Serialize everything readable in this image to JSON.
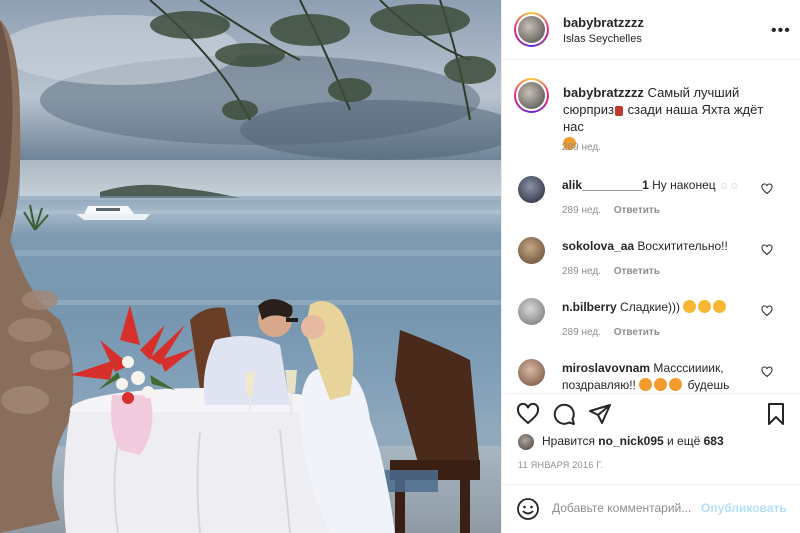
{
  "header": {
    "username": "babybratzzzz",
    "location": "Islas Seychelles"
  },
  "caption": {
    "username": "babybratzzzz",
    "text": "Самый лучший сюрприз",
    "text_after": "сзади наша Яхта ждёт нас",
    "time": "289 нед."
  },
  "comments": [
    {
      "username": "alik_________1",
      "text": "Ну наконец",
      "time": "289 нед.",
      "reply": "Ответить"
    },
    {
      "username": "sokolova_aa",
      "text": "Восхитительно!!",
      "time": "289 нед.",
      "reply": "Ответить"
    },
    {
      "username": "n.bilberry",
      "text": "Сладкие)))",
      "time": "289 нед.",
      "reply": "Ответить"
    },
    {
      "username": "miroslavovnam",
      "text": "Масссиииик, поздравляю!!",
      "text_after": "будешь",
      "time": "",
      "reply": ""
    }
  ],
  "likes": {
    "prefix": "Нравится",
    "user": "no_nick095",
    "middle": "и ещё",
    "count": "683"
  },
  "date": "11 ЯНВАРЯ 2016 Г.",
  "add_comment": {
    "placeholder": "Добавьте комментарий...",
    "publish": "Опубликовать"
  },
  "icons": {
    "more": "more-options-icon",
    "like": "heart-icon",
    "comment": "comment-icon",
    "share": "share-icon",
    "save": "bookmark-icon",
    "emoji": "emoji-icon"
  },
  "colors": {
    "link_disabled": "#b2dffc",
    "muted": "#8e8e8e",
    "text": "#262626",
    "story_ring": "#ee2a7b"
  }
}
